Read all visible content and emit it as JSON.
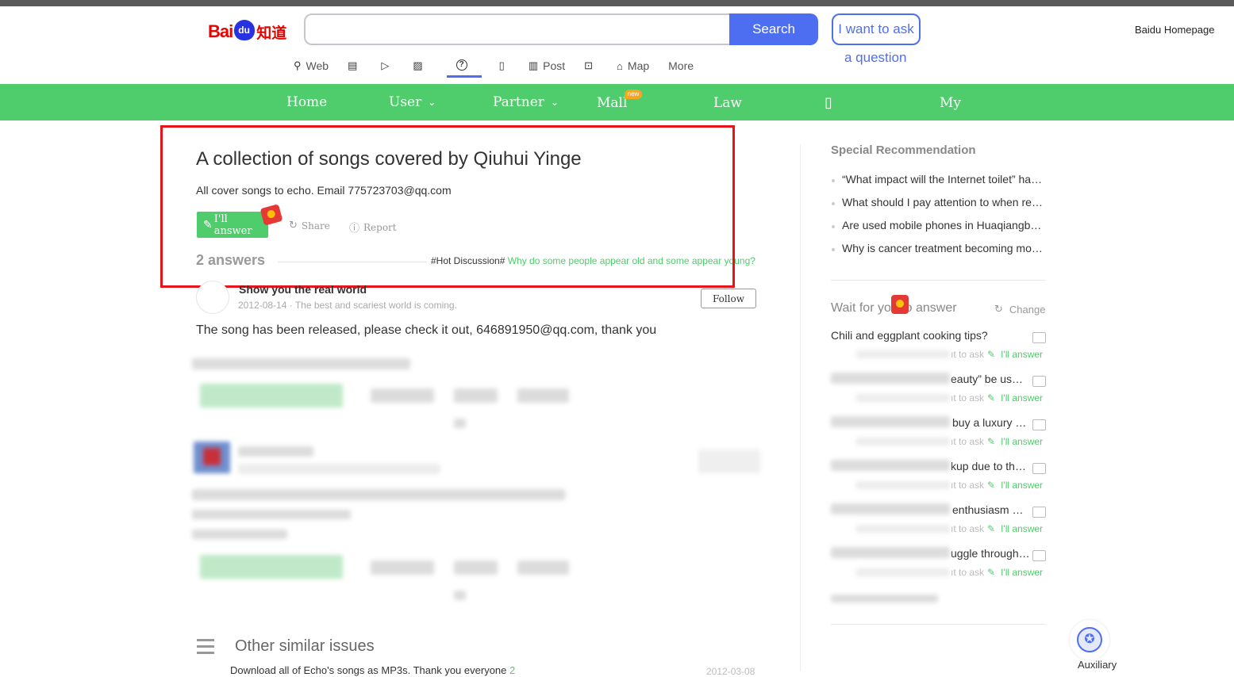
{
  "header": {
    "logo_text_red": "Bai",
    "logo_text_cn": "知道",
    "search_placeholder": "",
    "search_button": "Search",
    "ask_button": "I want to ask",
    "ask_sub": "a question",
    "homepage_link": "Baidu Homepage"
  },
  "subnav": [
    {
      "icon": "search-icon",
      "glyph": "⚲",
      "label": "Web"
    },
    {
      "icon": "news-icon",
      "glyph": "▤",
      "label": ""
    },
    {
      "icon": "video-icon",
      "glyph": "▷",
      "label": ""
    },
    {
      "icon": "image-icon",
      "glyph": "▨",
      "label": ""
    },
    {
      "icon": "question-icon",
      "glyph": "?",
      "label": "",
      "active": true
    },
    {
      "icon": "library-icon",
      "glyph": "▯",
      "label": ""
    },
    {
      "icon": "post-icon",
      "glyph": "▥",
      "label": "Post"
    },
    {
      "icon": "bag-icon",
      "glyph": "⊡",
      "label": ""
    },
    {
      "icon": "map-icon",
      "glyph": "⌂",
      "label": "Map"
    },
    {
      "icon": "",
      "glyph": "",
      "label": "More"
    }
  ],
  "greennav": {
    "home": "Home",
    "user": "User",
    "partner": "Partner",
    "mall": "Mall",
    "mall_badge": "new",
    "law": "Law",
    "phone_glyph": "▯",
    "my": "My"
  },
  "question": {
    "title": "A collection of songs covered by Qiuhui Yinge",
    "description": "All cover songs to echo. Email 775723703@qq.com",
    "answer_button": "I'll answer",
    "answer_glyph": "✎",
    "share": "Share",
    "share_glyph": "↻",
    "report": "Report",
    "report_glyph": "ⓘ",
    "answers_count": "2 answers",
    "hot_prefix": "#Hot Discussion#",
    "hot_link": "Why do some people appear old and some appear young?"
  },
  "answer1": {
    "author": "Show you the real world",
    "meta": "2012-08-14 · The best and scariest world is coming.",
    "follow": "Follow",
    "text": "The song has been released, please check it out, 646891950@qq.com, thank you"
  },
  "similar": {
    "title": "Other similar issues",
    "item": "Download all of Echo's songs as MP3s. Thank you everyone",
    "item_count": "2",
    "date": "2012-03-08"
  },
  "sidebar": {
    "rec_title": "Special Recommendation",
    "recommendations": [
      "“What impact will the Internet toilet” have?",
      "What should I pay attention to when renting?",
      "Are used mobile phones in Huaqiangbei reliable?",
      "Why is cancer treatment becoming more expensive?"
    ],
    "wait_title": "Wait for you to answer",
    "change": "Change",
    "change_glyph": "↻",
    "wait_items": [
      {
        "q": "Chili and eggplant cooking tips?",
        "meta": "ıt to ask",
        "ans": "I'll answer"
      },
      {
        "q": "eauty” be us…",
        "meta": "ıt to ask",
        "ans": "I'll answer"
      },
      {
        "q": "buy a luxury …",
        "meta": "ıt to ask",
        "ans": "I'll answer"
      },
      {
        "q": "kup due to th…",
        "meta": "ıt to ask",
        "ans": "I'll answer"
      },
      {
        "q": "enthusiasm …",
        "meta": "ıt to ask",
        "ans": "I'll answer"
      },
      {
        "q": "uggle through…",
        "meta": "ıt to ask",
        "ans": "I'll answer"
      }
    ],
    "aux_label": "Auxiliary",
    "aux_glyph": "✪"
  },
  "colors": {
    "brand_blue": "#4e6ef2",
    "nav_green": "#4fcc6b",
    "highlight_red": "#e8141c"
  }
}
